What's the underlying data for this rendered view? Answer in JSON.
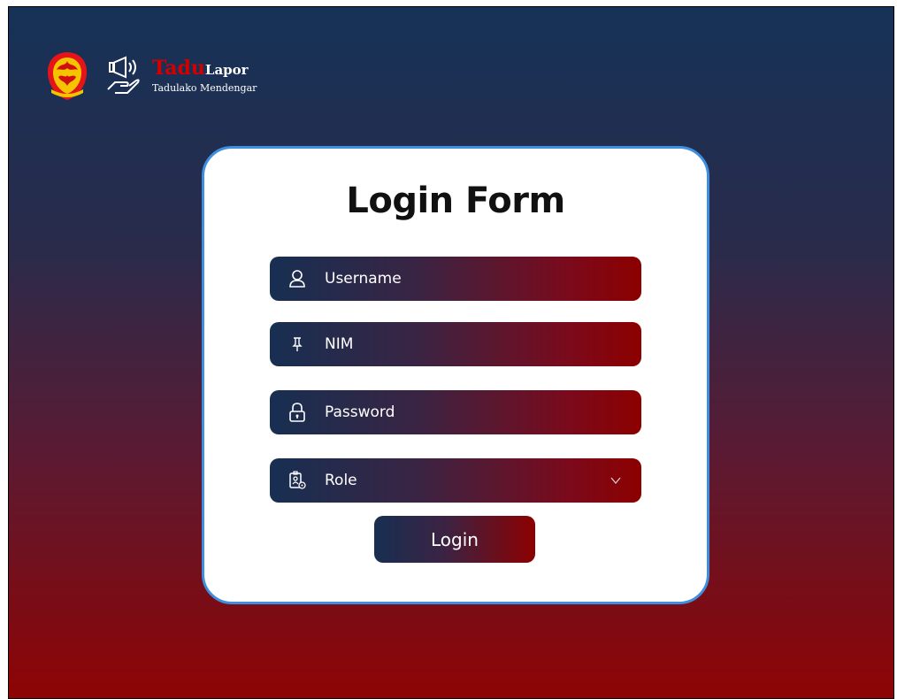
{
  "brand": {
    "name_part1": "Tadu",
    "name_part2": "Lapor",
    "tagline": "Tadulako Mendengar",
    "emblem_icon": "university-emblem-icon",
    "logo_icon": "megaphone-hand-icon"
  },
  "form": {
    "title": "Login Form",
    "fields": [
      {
        "label": "Username",
        "icon": "user-icon"
      },
      {
        "label": "NIM",
        "icon": "pin-icon"
      },
      {
        "label": "Password",
        "icon": "lock-icon"
      },
      {
        "label": "Role",
        "icon": "id-badge-icon"
      }
    ],
    "login_label": "Login"
  },
  "colors": {
    "background_top": "#153257",
    "background_bottom": "#8e0404",
    "card_border": "#3f8fe0",
    "brand_red": "#d40000"
  }
}
